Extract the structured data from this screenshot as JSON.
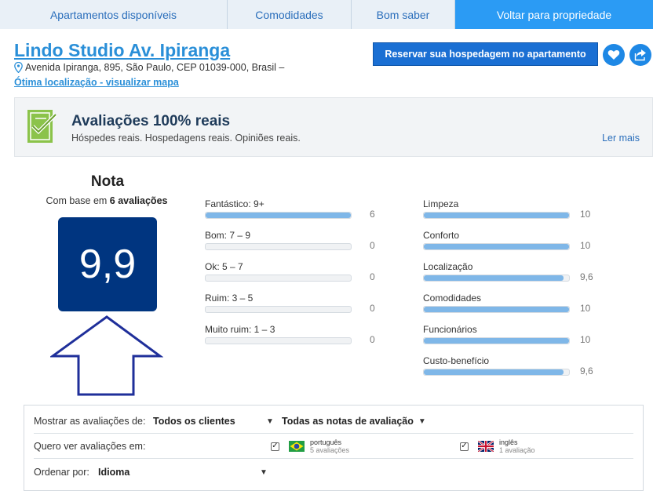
{
  "tabs": [
    "Apartamentos disponíveis",
    "Comodidades",
    "Bom saber",
    "Voltar para propriedade"
  ],
  "property": {
    "title": "Lindo Studio Av. Ipiranga",
    "address": "Avenida Ipiranga, 895, São Paulo, CEP 01039-000, Brasil –",
    "map_link": "Ótima localização - visualizar mapa",
    "reserve_label": "Reservar sua hospedagem no apartamento"
  },
  "banner": {
    "title": "Avaliações 100% reais",
    "subtitle": "Hóspedes reais. Hospedagens reais. Opiniões reais.",
    "more": "Ler mais"
  },
  "score": {
    "label": "Nota",
    "based_prefix": "Com base em ",
    "based_count": "6 avaliações",
    "value": "9,9"
  },
  "distribution": [
    {
      "label": "Fantástico: 9+",
      "count": "6",
      "fraction": 1.0
    },
    {
      "label": "Bom: 7 – 9",
      "count": "0",
      "fraction": 0
    },
    {
      "label": "Ok: 5 – 7",
      "count": "0",
      "fraction": 0
    },
    {
      "label": "Ruim: 3 – 5",
      "count": "0",
      "fraction": 0
    },
    {
      "label": "Muito ruim: 1 – 3",
      "count": "0",
      "fraction": 0
    }
  ],
  "categories": [
    {
      "label": "Limpeza",
      "value": "10",
      "fraction": 1.0
    },
    {
      "label": "Conforto",
      "value": "10",
      "fraction": 1.0
    },
    {
      "label": "Localização",
      "value": "9,6",
      "fraction": 0.96
    },
    {
      "label": "Comodidades",
      "value": "10",
      "fraction": 1.0
    },
    {
      "label": "Funcionários",
      "value": "10",
      "fraction": 1.0
    },
    {
      "label": "Custo-benefício",
      "value": "9,6",
      "fraction": 0.96
    }
  ],
  "filters": {
    "show_label": "Mostrar as avaliações de:",
    "show_value": "Todos os clientes",
    "notes_value": "Todas as notas de avaliação",
    "lang_label": "Quero ver avaliações em:",
    "langs": [
      {
        "name": "português",
        "count": "5 avaliações",
        "checked": true
      },
      {
        "name": "inglês",
        "count": "1 avaliação",
        "checked": true
      }
    ],
    "sort_label": "Ordenar por:",
    "sort_value": "Idioma"
  },
  "colors": {
    "accent": "#2b9bf4",
    "score_bg": "#003580",
    "bar_fill": "#7fb7e8",
    "link": "#2a8fd8"
  }
}
